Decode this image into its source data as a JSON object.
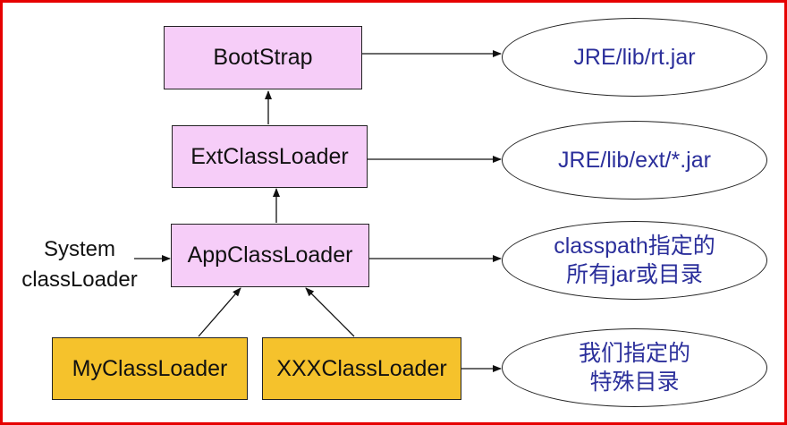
{
  "frame_color": "#e60000",
  "box_colors": {
    "pink": "#f6cdf8",
    "gold": "#f5c22c",
    "ellipse_text": "#2b2f9b"
  },
  "loaders": {
    "bootstrap": "BootStrap",
    "ext": "ExtClassLoader",
    "app": "AppClassLoader",
    "my": "MyClassLoader",
    "xxx": "XXXClassLoader"
  },
  "targets": {
    "bootstrap": [
      "JRE/lib/rt.jar"
    ],
    "ext": [
      "JRE/lib/ext/*.jar"
    ],
    "app": [
      "classpath指定的",
      "所有jar或目录"
    ],
    "custom": [
      "我们指定的",
      "特殊目录"
    ]
  },
  "system_label": [
    "System",
    "classLoader"
  ]
}
